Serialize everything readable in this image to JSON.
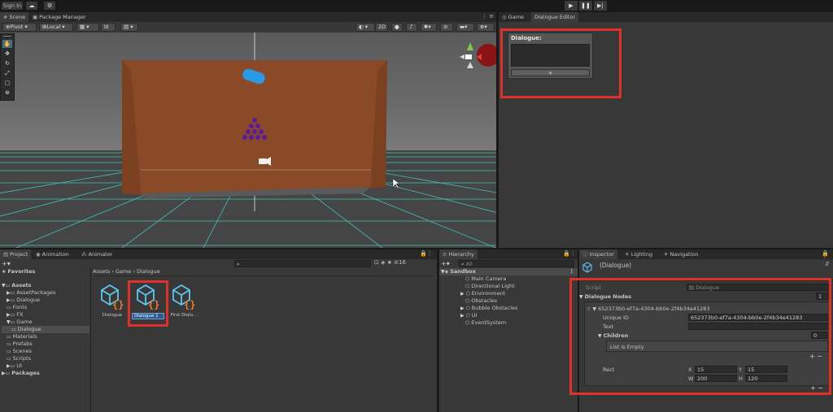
{
  "toolbar_top": {
    "signin_label": "Sign In",
    "cloud_icon": "cloud-icon",
    "collab_icon": "collab-icon",
    "play_icon": "▶",
    "pause_icon": "❚❚",
    "step_icon": "▶|"
  },
  "scene_tabs": [
    {
      "label": "Scene",
      "icon": "#"
    },
    {
      "label": "Package Manager",
      "icon": "▣"
    }
  ],
  "scene_toolbar": {
    "pivot": "Pivot",
    "local": "Local",
    "mode_2d": "2D"
  },
  "game_tabs": [
    {
      "label": "Game",
      "icon": "◎"
    },
    {
      "label": "Dialogue Editor"
    }
  ],
  "dialogue_editor": {
    "node_title": "Dialogue:",
    "add_button": "+"
  },
  "project": {
    "tabs": [
      {
        "label": "Project",
        "icon": "▤"
      },
      {
        "label": "Animation",
        "icon": "◉"
      },
      {
        "label": "Animator",
        "icon": "⁂"
      }
    ],
    "hidden_count": "16",
    "favorites": "Favorites",
    "assets_root": "Assets",
    "tree": [
      {
        "label": "AssetPackages",
        "indent": 1,
        "fold": "▶"
      },
      {
        "label": "Dialogue",
        "indent": 1,
        "fold": "▶"
      },
      {
        "label": "Fonts",
        "indent": 1,
        "fold": ""
      },
      {
        "label": "FX",
        "indent": 1,
        "fold": "▶"
      },
      {
        "label": "Game",
        "indent": 1,
        "fold": "▼"
      },
      {
        "label": "Dialogue",
        "indent": 2,
        "fold": "",
        "selected": true
      },
      {
        "label": "Materials",
        "indent": 1,
        "fold": ""
      },
      {
        "label": "Prefabs",
        "indent": 1,
        "fold": ""
      },
      {
        "label": "Scenes",
        "indent": 1,
        "fold": ""
      },
      {
        "label": "Scripts",
        "indent": 1,
        "fold": ""
      },
      {
        "label": "UI",
        "indent": 1,
        "fold": "▶"
      }
    ],
    "packages": "Packages",
    "breadcrumb": [
      "Assets",
      "Game",
      "Dialogue"
    ],
    "assets": [
      {
        "label": "Dialogue"
      },
      {
        "label": "Dialogue 1",
        "renaming": true
      },
      {
        "label": "First Dialo..."
      }
    ]
  },
  "hierarchy": {
    "tab": "Hierarchy",
    "search_placeholder": "All",
    "scene": "Sandbox",
    "items": [
      {
        "label": "Main Camera",
        "fold": ""
      },
      {
        "label": "Directional Light",
        "fold": ""
      },
      {
        "label": "Environment",
        "fold": "▶"
      },
      {
        "label": "Obstacles",
        "fold": ""
      },
      {
        "label": "Bubble Obstacles",
        "fold": "▶"
      },
      {
        "label": "UI",
        "fold": "▶"
      },
      {
        "label": "EventSystem",
        "fold": ""
      }
    ]
  },
  "inspector": {
    "tabs": [
      {
        "label": "Inspector",
        "icon": "ⓘ"
      },
      {
        "label": "Lighting",
        "icon": "☀"
      },
      {
        "label": "Navigation",
        "icon": "✈"
      }
    ],
    "object_name": "(Dialogue)",
    "script_label": "Script",
    "script_value": "Dialogue",
    "nodes_label": "Dialogue Nodes",
    "nodes_count": "1",
    "node_id_header": "652373b0-ef7a-4304-bb0e-2f4b34e41283",
    "unique_id_label": "Unique ID",
    "unique_id_value": "652373b0-ef7a-4304-bb0e-2f4b34e41283",
    "text_label": "Text",
    "text_value": "",
    "children_label": "Children",
    "children_count": "0",
    "list_empty": "List is Empty",
    "rect_label": "Rect",
    "rect": {
      "x_label": "X",
      "x": "15",
      "y_label": "Y",
      "y": "15",
      "w_label": "W",
      "w": "200",
      "h_label": "H",
      "h": "120"
    },
    "plus": "+",
    "minus": "−"
  },
  "colors": {
    "highlight_red": "#e0302a",
    "grid_cyan": "#3fd8c8",
    "board_brown": "#8a4a28",
    "ball_purple": "#5a1a9a",
    "capsule_blue": "#2a9ae8",
    "asset_icon_blue": "#5ec6f0",
    "asset_icon_orange": "#f07a2a"
  }
}
